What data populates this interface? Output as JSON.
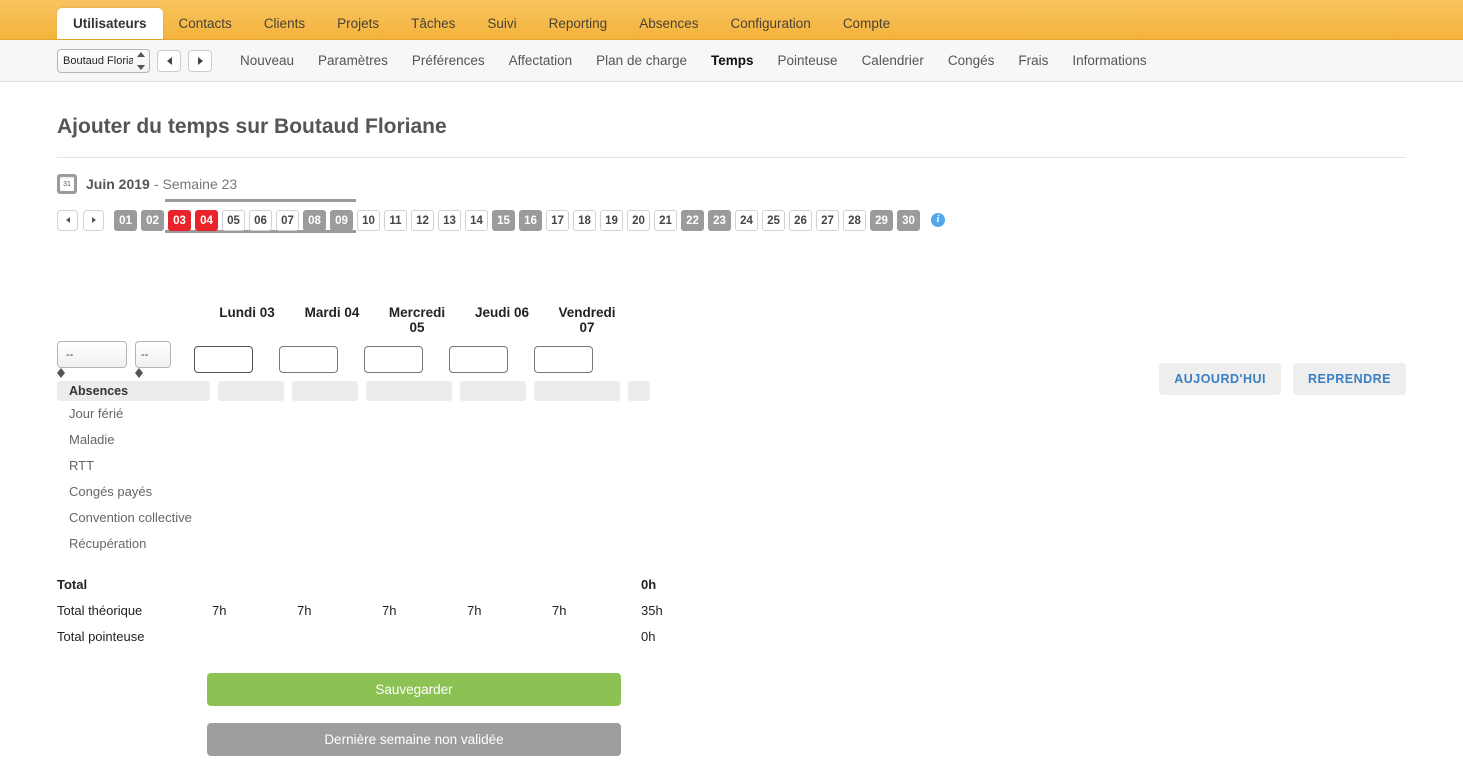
{
  "topnav": {
    "tabs": [
      {
        "label": "Utilisateurs",
        "active": true
      },
      {
        "label": "Contacts",
        "active": false
      },
      {
        "label": "Clients",
        "active": false
      },
      {
        "label": "Projets",
        "active": false
      },
      {
        "label": "Tâches",
        "active": false
      },
      {
        "label": "Suivi",
        "active": false
      },
      {
        "label": "Reporting",
        "active": false
      },
      {
        "label": "Absences",
        "active": false
      },
      {
        "label": "Configuration",
        "active": false
      },
      {
        "label": "Compte",
        "active": false
      }
    ]
  },
  "subnav": {
    "user_select": {
      "value": "Boutaud Floria",
      "options": [
        "Boutaud Floria"
      ]
    },
    "prev_label": "◀",
    "next_label": "▶",
    "links": [
      {
        "label": "Nouveau",
        "active": false
      },
      {
        "label": "Paramètres",
        "active": false
      },
      {
        "label": "Préférences",
        "active": false
      },
      {
        "label": "Affectation",
        "active": false
      },
      {
        "label": "Plan de charge",
        "active": false
      },
      {
        "label": "Temps",
        "active": true
      },
      {
        "label": "Pointeuse",
        "active": false
      },
      {
        "label": "Calendrier",
        "active": false
      },
      {
        "label": "Congés",
        "active": false
      },
      {
        "label": "Frais",
        "active": false
      },
      {
        "label": "Informations",
        "active": false
      }
    ]
  },
  "page": {
    "title": "Ajouter du temps sur Boutaud Floriane",
    "calendar_icon_day": "31",
    "month": "Juin 2019",
    "separator": "-",
    "week": "Semaine 23",
    "info_icon": "i"
  },
  "daystrip": {
    "prev": "◀",
    "next": "▶",
    "days": [
      {
        "label": "01",
        "state": "weekend"
      },
      {
        "label": "02",
        "state": "weekend"
      },
      {
        "label": "03",
        "state": "today"
      },
      {
        "label": "04",
        "state": "today"
      },
      {
        "label": "05",
        "state": "normal"
      },
      {
        "label": "06",
        "state": "normal"
      },
      {
        "label": "07",
        "state": "normal"
      },
      {
        "label": "08",
        "state": "weekend"
      },
      {
        "label": "09",
        "state": "weekend"
      },
      {
        "label": "10",
        "state": "normal"
      },
      {
        "label": "11",
        "state": "normal"
      },
      {
        "label": "12",
        "state": "normal"
      },
      {
        "label": "13",
        "state": "normal"
      },
      {
        "label": "14",
        "state": "normal"
      },
      {
        "label": "15",
        "state": "weekend"
      },
      {
        "label": "16",
        "state": "weekend"
      },
      {
        "label": "17",
        "state": "normal"
      },
      {
        "label": "18",
        "state": "normal"
      },
      {
        "label": "19",
        "state": "normal"
      },
      {
        "label": "20",
        "state": "normal"
      },
      {
        "label": "21",
        "state": "normal"
      },
      {
        "label": "22",
        "state": "weekend"
      },
      {
        "label": "23",
        "state": "weekend"
      },
      {
        "label": "24",
        "state": "normal"
      },
      {
        "label": "25",
        "state": "normal"
      },
      {
        "label": "26",
        "state": "normal"
      },
      {
        "label": "27",
        "state": "normal"
      },
      {
        "label": "28",
        "state": "normal"
      },
      {
        "label": "29",
        "state": "weekend"
      },
      {
        "label": "30",
        "state": "weekend"
      }
    ],
    "selected_week_start_index": 2,
    "selected_week_end_index": 8
  },
  "top_actions": {
    "today_label": "AUJOURD'HUI",
    "resume_label": "REPRENDRE"
  },
  "sheet": {
    "day_headers": [
      "Lundi 03",
      "Mardi 04",
      "Mercredi 05",
      "Jeudi 06",
      "Vendredi 07"
    ],
    "project_select": {
      "value": "--",
      "options": [
        "--"
      ]
    },
    "task_select": {
      "value": "--",
      "options": [
        "--"
      ]
    },
    "day_inputs": [
      "",
      "",
      "",
      "",
      ""
    ],
    "day_input_placeholder": "",
    "absences_label": "Absences",
    "absence_types": [
      "Jour férié",
      "Maladie",
      "RTT",
      "Congés payés",
      "Convention collective",
      "Récupération"
    ]
  },
  "totals": [
    {
      "label": "Total",
      "cells": [
        "",
        "",
        "",
        "",
        ""
      ],
      "sum": "0h",
      "bold": true
    },
    {
      "label": "Total théorique",
      "cells": [
        "7h",
        "7h",
        "7h",
        "7h",
        "7h"
      ],
      "sum": "35h",
      "bold": false
    },
    {
      "label": "Total pointeuse",
      "cells": [
        "",
        "",
        "",
        "",
        ""
      ],
      "sum": "0h",
      "bold": false
    }
  ],
  "bottom": {
    "save_label": "Sauvegarder",
    "locked_label": "Dernière semaine non validée"
  },
  "colors": {
    "brand_orange": "#f4b33c",
    "today_red": "#e8232a",
    "weekend_grey": "#9b9b9b",
    "save_green": "#8cc153",
    "link_blue": "#3a7fc1",
    "info_blue": "#4fa8ea"
  }
}
